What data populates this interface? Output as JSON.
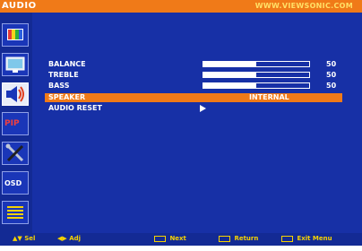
{
  "header": {
    "title": "AUDIO",
    "url": "WWW.VIEWSONIC.COM"
  },
  "sidebar": [
    {
      "name": "color-icon"
    },
    {
      "name": "display-icon"
    },
    {
      "name": "audio-icon",
      "selected": true
    },
    {
      "name": "pip-icon",
      "text": "PIP"
    },
    {
      "name": "setup-icon"
    },
    {
      "name": "osd-icon",
      "text": "OSD"
    },
    {
      "name": "menu-icon"
    }
  ],
  "menu": {
    "balance": {
      "label": "BALANCE",
      "value": "50",
      "level": 0.5
    },
    "treble": {
      "label": "TREBLE",
      "value": "50",
      "level": 0.5
    },
    "bass": {
      "label": "BASS",
      "value": "50",
      "level": 0.5
    },
    "speaker": {
      "label": "SPEAKER",
      "value": "INTERNAL"
    },
    "audio_reset": {
      "label": "AUDIO RESET"
    }
  },
  "footer": {
    "select": "Sel",
    "adjust": "Adj",
    "next": "Next",
    "return": "Return",
    "exit": "Exit Menu"
  },
  "colors": {
    "accent": "#f07a18",
    "background": "#1730a6",
    "footer_text": "#f6d200"
  }
}
